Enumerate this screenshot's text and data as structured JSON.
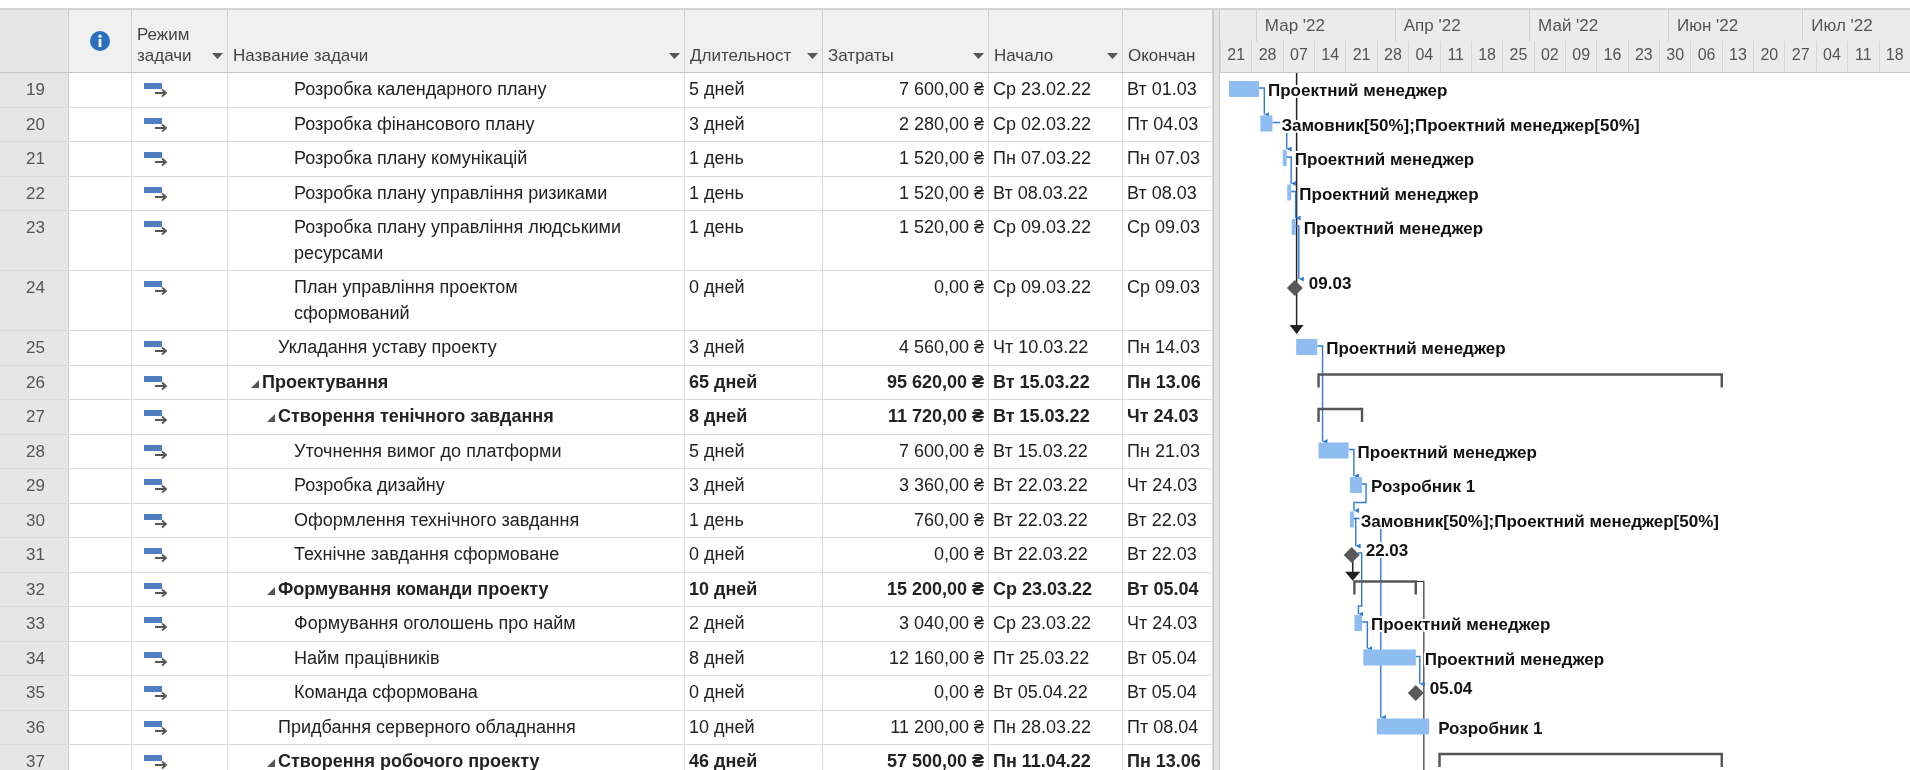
{
  "table": {
    "columns": [
      {
        "kind": "icon"
      },
      {
        "kind": "text",
        "label": "Режим задачи",
        "dropdown": true
      },
      {
        "kind": "text",
        "label": "Название задачи",
        "dropdown": true
      },
      {
        "kind": "text",
        "label": "Длительност",
        "dropdown": true
      },
      {
        "kind": "text",
        "label": "Затраты",
        "dropdown": true
      },
      {
        "kind": "text",
        "label": "Начало",
        "dropdown": true
      },
      {
        "kind": "text",
        "label": "Окончан",
        "dropdown": false
      }
    ]
  },
  "timescale": {
    "months": [
      "Мар '22",
      "Апр '22",
      "Май '22",
      "Июн '22",
      "Июл '22"
    ],
    "weeks": [
      "21",
      "28",
      "07",
      "14",
      "21",
      "28",
      "04",
      "11",
      "18",
      "25",
      "02",
      "09",
      "16",
      "23",
      "30",
      "06",
      "13",
      "20",
      "27",
      "04",
      "11",
      "18"
    ]
  },
  "tasks": [
    {
      "children": [
        {
          "children": [
            {
              "id": "19",
              "auto_scheduled": true,
              "kind": "task",
              "name": "Розробка календарного плану",
              "duration": "5 дней",
              "cost": "7 600,00 ₴",
              "start": "Ср 23.02.22",
              "finish": "Вт 01.03",
              "bar_label": "Проектний менеджер"
            },
            {
              "id": "20",
              "auto_scheduled": true,
              "kind": "task",
              "name": "Розробка фінансового плану",
              "duration": "3 дней",
              "cost": "2 280,00 ₴",
              "start": "Ср 02.03.22",
              "finish": "Пт 04.03",
              "bar_label": "Замовник[50%];Проектний менеджер[50%]"
            },
            {
              "id": "21",
              "auto_scheduled": true,
              "kind": "task",
              "name": "Розробка плану комунікацій",
              "duration": "1 день",
              "cost": "1 520,00 ₴",
              "start": "Пн 07.03.22",
              "finish": "Пн 07.03",
              "bar_label": "Проектний менеджер"
            },
            {
              "id": "22",
              "auto_scheduled": true,
              "kind": "task",
              "name": "Розробка плану управління ризиками",
              "duration": "1 день",
              "cost": "1 520,00 ₴",
              "start": "Вт 08.03.22",
              "finish": "Вт 08.03",
              "bar_label": "Проектний менеджер"
            },
            {
              "id": "23",
              "auto_scheduled": true,
              "kind": "task",
              "name": "Розробка плану управління людськими ресурсами",
              "duration": "1 день",
              "cost": "1 520,00 ₴",
              "start": "Ср 09.03.22",
              "finish": "Ср 09.03",
              "bar_label": "Проектний менеджер"
            },
            {
              "id": "24",
              "auto_scheduled": true,
              "kind": "milestone",
              "name": "План управління проектом сформований",
              "duration": "0 дней",
              "cost": "0,00 ₴",
              "start": "Ср 09.03.22",
              "finish": "Ср 09.03",
              "bar_label": "09.03"
            }
          ]
        },
        {
          "id": "25",
          "auto_scheduled": true,
          "kind": "task",
          "name": "Укладання уставу проекту",
          "duration": "3 дней",
          "cost": "4 560,00 ₴",
          "start": "Чт 10.03.22",
          "finish": "Пн 14.03",
          "bar_label": "Проектний менеджер"
        }
      ]
    },
    {
      "id": "26",
      "auto_scheduled": true,
      "kind": "summary",
      "expanded": true,
      "name": "Проектування",
      "duration": "65 дней",
      "cost": "95 620,00 ₴",
      "start": "Вт 15.03.22",
      "finish": "Пн 13.06",
      "children": [
        {
          "id": "27",
          "auto_scheduled": true,
          "kind": "summary",
          "expanded": true,
          "name": "Створення тенічного завдання",
          "duration": "8 дней",
          "cost": "11 720,00 ₴",
          "start": "Вт 15.03.22",
          "finish": "Чт 24.03",
          "children": [
            {
              "id": "28",
              "auto_scheduled": true,
              "kind": "task",
              "name": "Уточнення вимог до платформи",
              "duration": "5 дней",
              "cost": "7 600,00 ₴",
              "start": "Вт 15.03.22",
              "finish": "Пн 21.03",
              "bar_label": "Проектний менеджер"
            },
            {
              "id": "29",
              "auto_scheduled": true,
              "kind": "task",
              "name": "Розробка дизайну",
              "duration": "3 дней",
              "cost": "3 360,00 ₴",
              "start": "Вт 22.03.22",
              "finish": "Чт 24.03",
              "bar_label": "Розробник 1"
            },
            {
              "id": "30",
              "auto_scheduled": true,
              "kind": "task",
              "name": "Оформлення технічного завдання",
              "duration": "1 день",
              "cost": "760,00 ₴",
              "start": "Вт 22.03.22",
              "finish": "Вт 22.03",
              "bar_label": "Замовник[50%];Проектний менеджер[50%]"
            },
            {
              "id": "31",
              "auto_scheduled": true,
              "kind": "milestone",
              "name": "Технічне завдання сформоване",
              "duration": "0 дней",
              "cost": "0,00 ₴",
              "start": "Вт 22.03.22",
              "finish": "Вт 22.03",
              "bar_label": "22.03"
            }
          ]
        },
        {
          "id": "32",
          "auto_scheduled": true,
          "kind": "summary",
          "expanded": true,
          "name": "Формування команди проекту",
          "duration": "10 дней",
          "cost": "15 200,00 ₴",
          "start": "Ср 23.03.22",
          "finish": "Вт 05.04",
          "children": [
            {
              "id": "33",
              "auto_scheduled": true,
              "kind": "task",
              "name": "Формування оголошень про найм",
              "duration": "2 дней",
              "cost": "3 040,00 ₴",
              "start": "Ср 23.03.22",
              "finish": "Чт 24.03",
              "bar_label": "Проектний менеджер"
            },
            {
              "id": "34",
              "auto_scheduled": true,
              "kind": "task",
              "name": "Найм працівників",
              "duration": "8 дней",
              "cost": "12 160,00 ₴",
              "start": "Пт 25.03.22",
              "finish": "Вт 05.04",
              "bar_label": "Проектний менеджер"
            },
            {
              "id": "35",
              "auto_scheduled": true,
              "kind": "milestone",
              "name": "Команда сформована",
              "duration": "0 дней",
              "cost": "0,00 ₴",
              "start": "Вт 05.04.22",
              "finish": "Вт 05.04",
              "bar_label": "05.04"
            }
          ]
        },
        {
          "id": "36",
          "auto_scheduled": true,
          "kind": "task",
          "name": "Придбання серверного обладнання",
          "duration": "10 дней",
          "cost": "11 200,00 ₴",
          "start": "Пн 28.03.22",
          "finish": "Пт 08.04",
          "bar_label": "Розробник 1"
        },
        {
          "id": "37",
          "auto_scheduled": true,
          "kind": "summary",
          "expanded": true,
          "name": "Створення робочого проекту",
          "duration": "46 дней",
          "cost": "57 500,00 ₴",
          "start": "Пн 11.04.22",
          "finish": "Пн 13.06"
        }
      ]
    }
  ]
}
